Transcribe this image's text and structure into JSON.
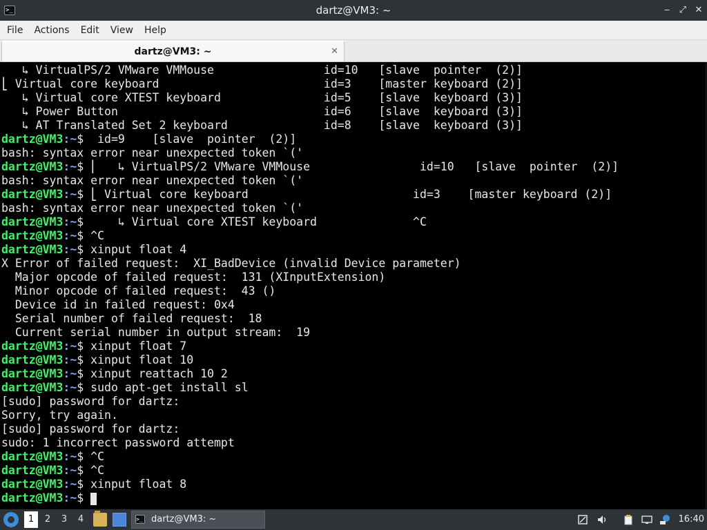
{
  "window": {
    "title": "dartz@VM3: ~"
  },
  "menu": {
    "items": [
      "File",
      "Actions",
      "Edit",
      "View",
      "Help"
    ]
  },
  "tabs": [
    {
      "label": "dartz@VM3: ~",
      "close": "✕"
    }
  ],
  "terminal": {
    "prompt_user": "dartz@VM3",
    "prompt_path": ":~",
    "prompt_sym": "$",
    "lines": [
      {
        "p": false,
        "text": "   ↳ VirtualPS/2 VMware VMMouse                id=10   [slave  pointer  (2)]"
      },
      {
        "p": false,
        "text": "⎣ Virtual core keyboard                        id=3    [master keyboard (2)]"
      },
      {
        "p": false,
        "text": "   ↳ Virtual core XTEST keyboard               id=5    [slave  keyboard (3)]"
      },
      {
        "p": false,
        "text": "   ↳ Power Button                              id=6    [slave  keyboard (3)]"
      },
      {
        "p": false,
        "text": "   ↳ AT Translated Set 2 keyboard              id=8    [slave  keyboard (3)]"
      },
      {
        "p": true,
        "text": "  id=9    [slave  pointer  (2)]"
      },
      {
        "p": false,
        "text": "bash: syntax error near unexpected token `('"
      },
      {
        "p": true,
        "text": " ⎜   ↳ VirtualPS/2 VMware VMMouse                id=10   [slave  pointer  (2)]"
      },
      {
        "p": false,
        "text": "bash: syntax error near unexpected token `('"
      },
      {
        "p": true,
        "text": " ⎣ Virtual core keyboard                        id=3    [master keyboard (2)]"
      },
      {
        "p": false,
        "text": "bash: syntax error near unexpected token `('"
      },
      {
        "p": true,
        "text": "     ↳ Virtual core XTEST keyboard              ^C"
      },
      {
        "p": true,
        "text": " ^C"
      },
      {
        "p": true,
        "text": " xinput float 4"
      },
      {
        "p": false,
        "text": "X Error of failed request:  XI_BadDevice (invalid Device parameter)"
      },
      {
        "p": false,
        "text": "  Major opcode of failed request:  131 (XInputExtension)"
      },
      {
        "p": false,
        "text": "  Minor opcode of failed request:  43 ()"
      },
      {
        "p": false,
        "text": "  Device id in failed request: 0x4"
      },
      {
        "p": false,
        "text": "  Serial number of failed request:  18"
      },
      {
        "p": false,
        "text": "  Current serial number in output stream:  19"
      },
      {
        "p": true,
        "text": " xinput float 7"
      },
      {
        "p": true,
        "text": " xinput float 10"
      },
      {
        "p": true,
        "text": " xinput reattach 10 2"
      },
      {
        "p": true,
        "text": " sudo apt-get install sl"
      },
      {
        "p": false,
        "text": "[sudo] password for dartz:"
      },
      {
        "p": false,
        "text": "Sorry, try again."
      },
      {
        "p": false,
        "text": "[sudo] password for dartz:"
      },
      {
        "p": false,
        "text": "sudo: 1 incorrect password attempt"
      },
      {
        "p": true,
        "text": " ^C"
      },
      {
        "p": true,
        "text": " ^C"
      },
      {
        "p": true,
        "text": " xinput float 8"
      },
      {
        "p": true,
        "text": " ",
        "cursor": true
      }
    ]
  },
  "taskbar": {
    "workspaces": [
      "1",
      "2",
      "3",
      "4"
    ],
    "active_workspace": "1",
    "task_label": "dartz@VM3: ~",
    "clock": "16:40",
    "icons": {
      "start": "start-menu-icon",
      "file_manager": "file-manager-icon",
      "desktop": "show-desktop-icon",
      "tray": [
        "screenshot-icon",
        "volume-icon",
        "clipboard-icon",
        "network-icon",
        "update-icon"
      ]
    }
  }
}
